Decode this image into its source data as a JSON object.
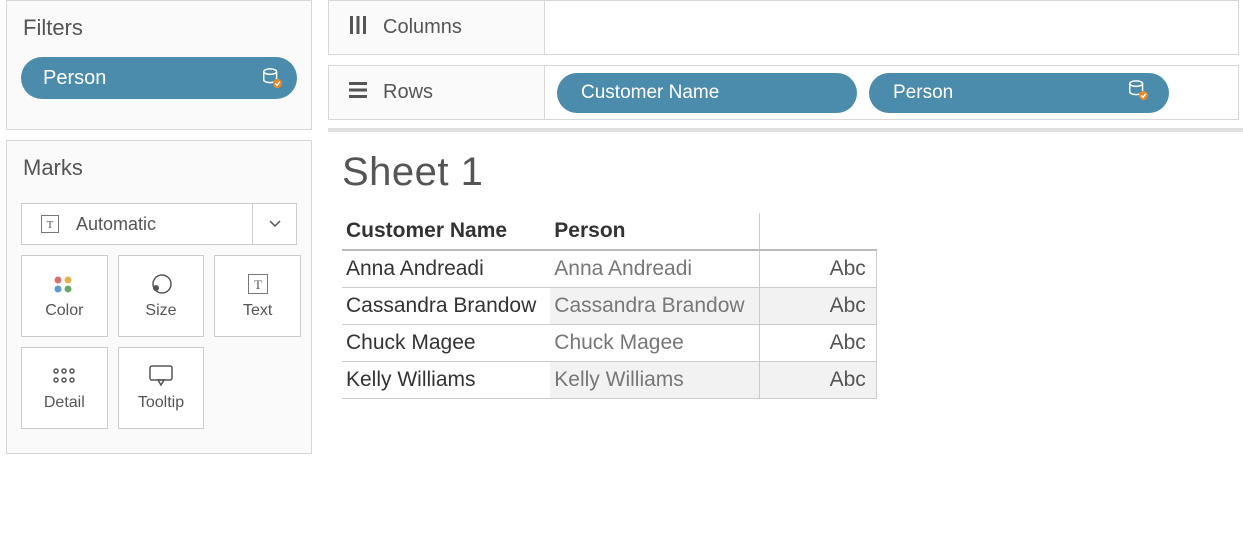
{
  "filters": {
    "title": "Filters",
    "items": [
      {
        "label": "Person",
        "has_filter_icon": true
      }
    ]
  },
  "marks": {
    "title": "Marks",
    "mark_type": "Automatic",
    "buttons": [
      {
        "label": "Color"
      },
      {
        "label": "Size"
      },
      {
        "label": "Text"
      },
      {
        "label": "Detail"
      },
      {
        "label": "Tooltip"
      }
    ]
  },
  "shelves": {
    "columns": {
      "title": "Columns",
      "fields": []
    },
    "rows": {
      "title": "Rows",
      "fields": [
        {
          "label": "Customer Name",
          "has_filter_icon": false
        },
        {
          "label": "Person",
          "has_filter_icon": true
        }
      ]
    }
  },
  "viz": {
    "sheet_title": "Sheet 1",
    "columns": [
      "Customer Name",
      "Person"
    ],
    "measure_placeholder": "Abc",
    "rows": [
      {
        "customer_name": "Anna Andreadi",
        "person": "Anna Andreadi"
      },
      {
        "customer_name": "Cassandra Brandow",
        "person": "Cassandra Brandow"
      },
      {
        "customer_name": "Chuck Magee",
        "person": "Chuck Magee"
      },
      {
        "customer_name": "Kelly Williams",
        "person": "Kelly Williams"
      }
    ]
  },
  "colors": {
    "pill": "#4b8bab",
    "pill_text": "#ffffff",
    "panel_border": "#d7d7d7"
  }
}
